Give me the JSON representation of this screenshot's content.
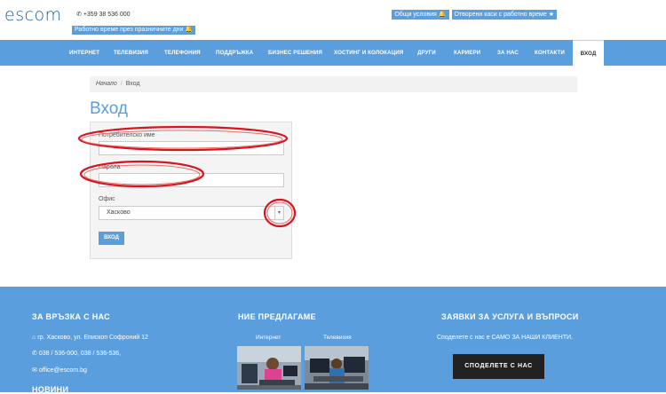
{
  "header": {
    "logo": "escom",
    "phone": "+359 38 536 000",
    "hours_badge": "Работно време през празничните дни",
    "top_links": [
      {
        "label": "Общи условия"
      },
      {
        "label": "Отворени каси с работно време"
      }
    ]
  },
  "nav": {
    "items": [
      {
        "label": "ИНТЕРНЕТ"
      },
      {
        "label": "ТЕЛЕВИЗИЯ"
      },
      {
        "label": "ТЕЛЕФОНИЯ"
      },
      {
        "label": "ПОДДРЪЖКА"
      },
      {
        "label": "БИЗНЕС РЕШЕНИЯ"
      },
      {
        "label": "ХОСТИНГ И КОЛОКАЦИЯ"
      },
      {
        "label": "ДРУГИ"
      },
      {
        "label": "КАРИЕРИ"
      },
      {
        "label": "ЗА НАС"
      },
      {
        "label": "КОНТАКТИ"
      },
      {
        "label": "ВХОД"
      }
    ],
    "active": "ВХОД"
  },
  "breadcrumb": {
    "home": "Начало",
    "separator": "/",
    "current": "Вход"
  },
  "page": {
    "title": "Вход"
  },
  "login_form": {
    "username_label": "Потребителско име",
    "username_value": "",
    "password_label": "Парола",
    "password_value": "",
    "office_label": "Офис",
    "office_value": "Хасково",
    "submit_label": "ВХОД"
  },
  "footer": {
    "contact": {
      "heading": "ЗА ВРЪЗКА С НАС",
      "address": "гр. Хасково, ул. Епископ Софроний 12",
      "phones": "038 / 536-000, 038 / 536-536,",
      "email": "office@escom.bg",
      "news_heading": "НОВИНИ"
    },
    "offers": {
      "heading": "НИЕ ПРЕДЛАГАМЕ",
      "items": [
        {
          "caption": "Интернет"
        },
        {
          "caption": "Телевизия"
        }
      ]
    },
    "requests": {
      "heading": "ЗАЯВКИ ЗА УСЛУГА И ВЪПРОСИ",
      "text": "Споделете с нас е САМО ЗА НАШИ КЛИЕНТИ.",
      "button": "СПОДЕЛЕТЕ С НАС"
    }
  },
  "colors": {
    "brand_blue": "#5b9ede",
    "logo_blue": "#1a5ea8",
    "annotation_red": "#d9141b"
  }
}
